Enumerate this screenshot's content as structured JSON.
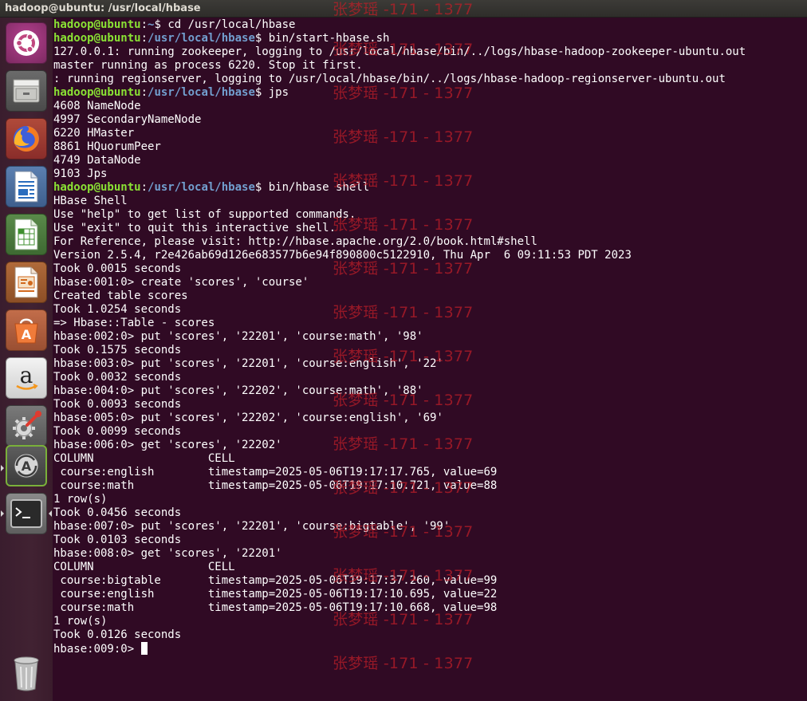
{
  "window": {
    "title": "hadoop@ubuntu: /usr/local/hbase"
  },
  "launcher": {
    "items": [
      {
        "name": "ubuntu-dash-icon"
      },
      {
        "name": "files-icon"
      },
      {
        "name": "firefox-icon"
      },
      {
        "name": "libreoffice-writer-icon"
      },
      {
        "name": "libreoffice-calc-icon"
      },
      {
        "name": "libreoffice-impress-icon"
      },
      {
        "name": "ubuntu-software-icon"
      },
      {
        "name": "amazon-icon"
      },
      {
        "name": "system-settings-icon"
      },
      {
        "name": "software-updater-icon"
      },
      {
        "name": "terminal-icon"
      },
      {
        "name": "trash-icon"
      }
    ]
  },
  "terminal": {
    "prompt_user": "hadoop@ubuntu",
    "lines": [
      {
        "prompt": true,
        "path": "~",
        "cmd": "cd /usr/local/hbase"
      },
      {
        "prompt": true,
        "path": "/usr/local/hbase",
        "cmd": "bin/start-hbase.sh"
      },
      {
        "text": "127.0.0.1: running zookeeper, logging to /usr/local/hbase/bin/../logs/hbase-hadoop-zookeeper-ubuntu.out"
      },
      {
        "text": "master running as process 6220. Stop it first."
      },
      {
        "text": ": running regionserver, logging to /usr/local/hbase/bin/../logs/hbase-hadoop-regionserver-ubuntu.out"
      },
      {
        "prompt": true,
        "path": "/usr/local/hbase",
        "cmd": "jps"
      },
      {
        "text": "4608 NameNode"
      },
      {
        "text": "4997 SecondaryNameNode"
      },
      {
        "text": "6220 HMaster"
      },
      {
        "text": "8861 HQuorumPeer"
      },
      {
        "text": "4749 DataNode"
      },
      {
        "text": "9103 Jps"
      },
      {
        "prompt": true,
        "path": "/usr/local/hbase",
        "cmd": "bin/hbase shell"
      },
      {
        "text": "HBase Shell"
      },
      {
        "text": "Use \"help\" to get list of supported commands."
      },
      {
        "text": "Use \"exit\" to quit this interactive shell."
      },
      {
        "text": "For Reference, please visit: http://hbase.apache.org/2.0/book.html#shell"
      },
      {
        "text": "Version 2.5.4, r2e426ab69d126e683577b6e94f890800c5122910, Thu Apr  6 09:11:53 PDT 2023"
      },
      {
        "text": "Took 0.0015 seconds"
      },
      {
        "text": "hbase:001:0> create 'scores', 'course'"
      },
      {
        "text": "Created table scores"
      },
      {
        "text": "Took 1.0254 seconds"
      },
      {
        "text": "=> Hbase::Table - scores"
      },
      {
        "text": "hbase:002:0> put 'scores', '22201', 'course:math', '98'"
      },
      {
        "text": "Took 0.1575 seconds"
      },
      {
        "text": "hbase:003:0> put 'scores', '22201', 'course:english', '22'"
      },
      {
        "text": "Took 0.0032 seconds"
      },
      {
        "text": "hbase:004:0> put 'scores', '22202', 'course:math', '88'"
      },
      {
        "text": "Took 0.0093 seconds"
      },
      {
        "text": "hbase:005:0> put 'scores', '22202', 'course:english', '69'"
      },
      {
        "text": "Took 0.0099 seconds"
      },
      {
        "text": "hbase:006:0> get 'scores', '22202'"
      },
      {
        "text": "COLUMN                 CELL"
      },
      {
        "text": " course:english        timestamp=2025-05-06T19:17:17.765, value=69"
      },
      {
        "text": " course:math           timestamp=2025-05-06T19:17:10.721, value=88"
      },
      {
        "text": "1 row(s)"
      },
      {
        "text": "Took 0.0456 seconds"
      },
      {
        "text": "hbase:007:0> put 'scores', '22201', 'course:bigtable', '99'"
      },
      {
        "text": "Took 0.0103 seconds"
      },
      {
        "text": "hbase:008:0> get 'scores', '22201'"
      },
      {
        "text": "COLUMN                 CELL"
      },
      {
        "text": " course:bigtable       timestamp=2025-05-06T19:17:37.260, value=99"
      },
      {
        "text": " course:english        timestamp=2025-05-06T19:17:10.695, value=22"
      },
      {
        "text": " course:math           timestamp=2025-05-06T19:17:10.668, value=98"
      },
      {
        "text": "1 row(s)"
      },
      {
        "text": "Took 0.0126 seconds"
      },
      {
        "text": "hbase:009:0> ",
        "cursor": true
      }
    ]
  },
  "watermark": {
    "text": "张梦瑶 -171 - 1377"
  },
  "colors": {
    "terminal_bg": "#300a24",
    "prompt_user": "#8ae234",
    "prompt_path": "#729fcf",
    "watermark": "#be1e28"
  }
}
